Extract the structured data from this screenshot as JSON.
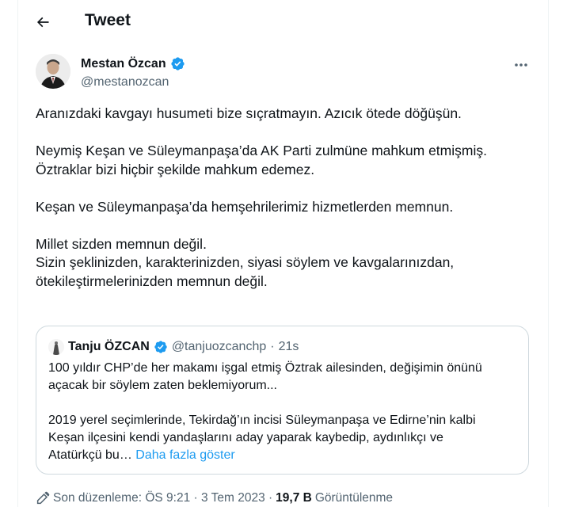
{
  "header": {
    "title": "Tweet",
    "back_icon": "arrow-left-icon"
  },
  "author": {
    "name": "Mestan Özcan",
    "handle": "@mestanozcan",
    "verified_icon": "verified-badge-icon",
    "verified_color": "#1d9bf0"
  },
  "tweet": {
    "paragraphs": [
      {
        "lines": [
          "Aranızdaki kavgayı husumeti bize sıçratmayın. Azıcık ötede döğüşün."
        ]
      },
      {
        "lines": [
          "Neymiş Keşan ve Süleymanpaşa’da AK Parti zulmüne mahkum etmişmiş.",
          "Öztraklar bizi hiçbir şekilde mahkum edemez."
        ]
      },
      {
        "lines": [
          "Keşan ve Süleymanpaşa’da hemşehrilerimiz hizmetlerden memnun."
        ]
      },
      {
        "lines": [
          "Millet sizden memnun değil.",
          "Sizin şeklinizden, karakterinizden, siyasi söylem ve kavgalarınızdan,",
          "ötekileştirmelerinizden memnun değil."
        ]
      }
    ]
  },
  "quote": {
    "name": "Tanju ÖZCAN",
    "handle": "@tanjuozcanchp",
    "separator": "·",
    "time": "21s",
    "lines1": [
      "100 yıldır CHP’de her makamı işgal etmiş Öztrak ailesinden, değişimin önünü",
      "açacak bir söylem zaten beklemiyorum..."
    ],
    "lines2": [
      "2019 yerel seçimlerinde, Tekirdağ’ın incisi  Süleymanpaşa ve Edirne’nin kalbi",
      "Keşan ilçesini kendi yandaşlarını aday yaparak kaybedip, aydınlıkçı ve"
    ],
    "last_line": "Atatürkçü bu…",
    "show_more": "Daha fazla göster"
  },
  "footer": {
    "edit_icon": "pencil-icon",
    "edited_label": "Son düzenleme: ÖS 9:21 · 3 Tem 2023 ·",
    "views_count": "19,7 B",
    "views_label": "Görüntülenme"
  },
  "colors": {
    "link": "#1d9bf0",
    "secondary_text": "#536471",
    "border": "#cfd9de"
  }
}
